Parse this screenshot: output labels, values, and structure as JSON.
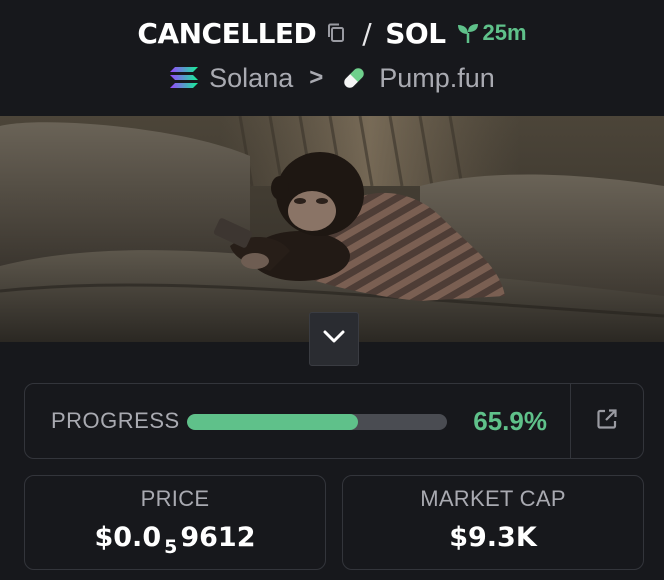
{
  "header": {
    "token_name": "CANCELLED",
    "separator": "/",
    "quote": "SOL",
    "age": "25m",
    "chain": "Solana",
    "chevron": ">",
    "dex": "Pump.fun"
  },
  "banner": {
    "description_icon": "token-banner-image",
    "expand_icon": "chevron-down-icon"
  },
  "progress": {
    "label": "PROGRESS",
    "value_text": "65.9%",
    "fraction": 0.659,
    "accent": "#5fc18a"
  },
  "stats": {
    "price": {
      "label": "PRICE",
      "prefix": "$0.0",
      "subscript_zeros": "5",
      "digits": "9612"
    },
    "market_cap": {
      "label": "MARKET CAP",
      "value": "$9.3K"
    }
  },
  "colors": {
    "background": "#17181c",
    "card_border": "#33353b",
    "muted_text": "#a9aab1",
    "green": "#5fc18a"
  }
}
